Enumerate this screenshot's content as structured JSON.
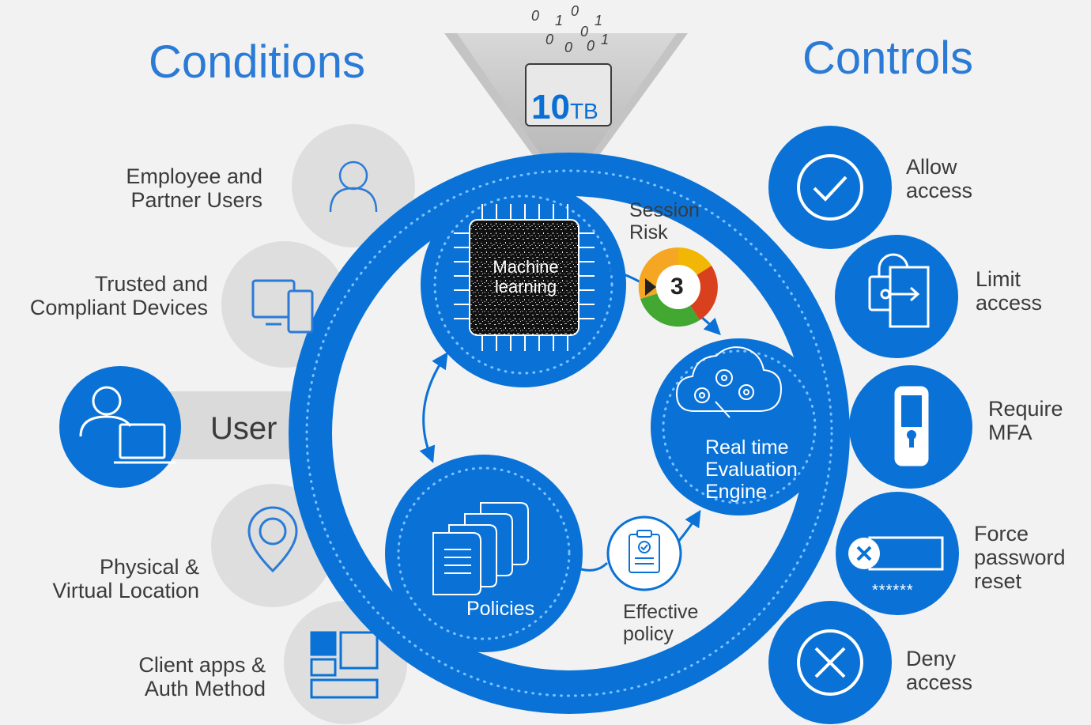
{
  "conditions": {
    "heading": "Conditions",
    "items": [
      {
        "label_line1": "Employee and",
        "label_line2": "Partner Users",
        "icon": "person-icon"
      },
      {
        "label_line1": "Trusted and",
        "label_line2": "Compliant Devices",
        "icon": "devices-icon"
      },
      {
        "label_line1": "Physical &",
        "label_line2": "Virtual Location",
        "icon": "location-pin-icon"
      },
      {
        "label_line1": "Client apps &",
        "label_line2": "Auth Method",
        "icon": "app-tiles-icon"
      }
    ]
  },
  "user": {
    "label": "User",
    "icon": "user-laptop-icon"
  },
  "data_funnel": {
    "size_value": "10",
    "size_unit": "TB",
    "binary_digits": [
      "0",
      "1",
      "0",
      "1",
      "0",
      "0",
      "0",
      "1",
      "0"
    ],
    "icon": "folder-binary-icon"
  },
  "machine_learning": {
    "line1": "Machine",
    "line2": "learning",
    "icon": "chip-icon"
  },
  "session_risk": {
    "line1": "Session",
    "line2": "Risk",
    "value": "3",
    "icon": "risk-gauge-icon"
  },
  "engine": {
    "line1": "Real time",
    "line2": "Evaluation",
    "line3": "Engine",
    "icon": "cloud-gears-icon"
  },
  "policies": {
    "label": "Policies",
    "icon": "documents-icon"
  },
  "effective_policy": {
    "line1": "Effective",
    "line2": "policy",
    "icon": "clipboard-check-icon"
  },
  "controls": {
    "heading": "Controls",
    "items": [
      {
        "label_line1": "Allow",
        "label_line2": "access",
        "label_line3": "",
        "icon": "check-circle-icon"
      },
      {
        "label_line1": "Limit",
        "label_line2": "access",
        "label_line3": "",
        "icon": "lock-exit-icon"
      },
      {
        "label_line1": "Require",
        "label_line2": "MFA",
        "label_line3": "",
        "icon": "phone-lock-icon"
      },
      {
        "label_line1": "Force",
        "label_line2": "password",
        "label_line3": "reset",
        "icon": "password-reset-icon"
      },
      {
        "label_line1": "Deny",
        "label_line2": "access",
        "label_line3": "",
        "icon": "deny-x-icon"
      }
    ],
    "password_mask": "******"
  },
  "colors": {
    "primary_blue": "#0a72d7",
    "light_blue": "#1e8ef0",
    "grey_circle": "#dedede",
    "background": "#f2f2f2",
    "heading_blue": "#2b7bd6"
  }
}
